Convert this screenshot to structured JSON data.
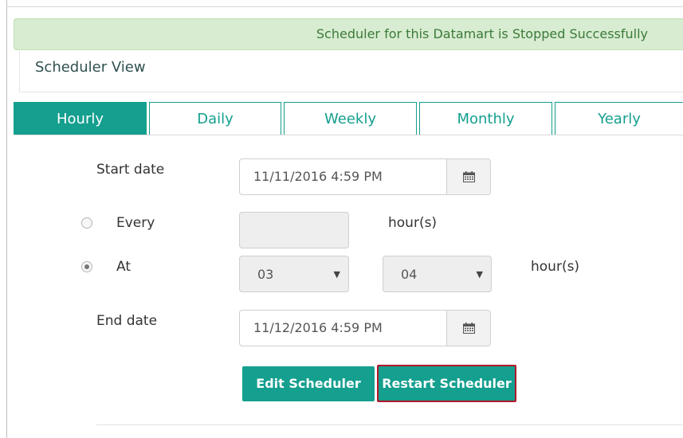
{
  "alert": {
    "message": "Scheduler for this Datamart is Stopped Successfully"
  },
  "panel": {
    "title": "Scheduler View"
  },
  "tabs": [
    {
      "label": "Hourly",
      "active": true
    },
    {
      "label": "Daily",
      "active": false
    },
    {
      "label": "Weekly",
      "active": false
    },
    {
      "label": "Monthly",
      "active": false
    },
    {
      "label": "Yearly",
      "active": false
    }
  ],
  "form": {
    "start_date": {
      "label": "Start date",
      "value": "11/11/2016 4:59 PM"
    },
    "every": {
      "label": "Every",
      "value": "",
      "unit": "hour(s)",
      "selected": false
    },
    "at": {
      "label": "At",
      "selected": true,
      "hour": "03",
      "minute": "04",
      "unit": "hour(s)"
    },
    "end_date": {
      "label": "End date",
      "value": "11/12/2016 4:59 PM"
    }
  },
  "buttons": {
    "edit": "Edit Scheduler",
    "restart": "Restart Scheduler"
  },
  "colors": {
    "accent": "#149f8e",
    "alert_bg": "#d7ecd0",
    "alert_text": "#3c7a3a",
    "highlight": "#b3172a"
  },
  "icons": {
    "calendar": "calendar-icon",
    "dropdown": "caret-down-icon"
  }
}
